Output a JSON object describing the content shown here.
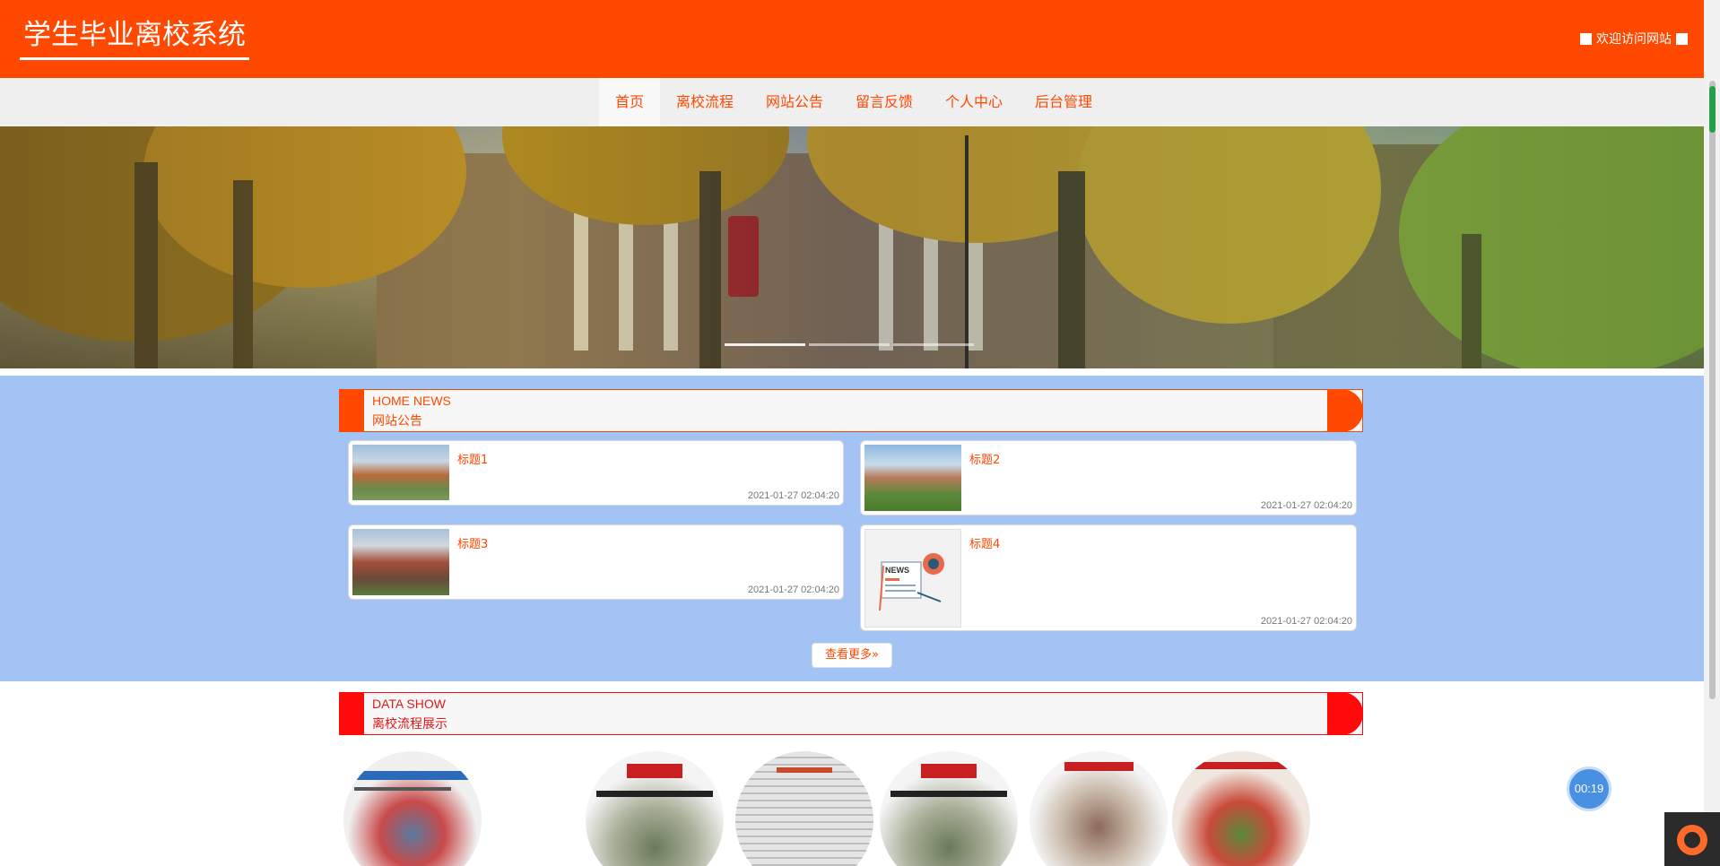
{
  "header": {
    "site_title": "学生毕业离校系统",
    "welcome": "欢迎访问网站",
    "bg_color": "#ff4800"
  },
  "nav": {
    "items": [
      {
        "label": "首页",
        "active": true
      },
      {
        "label": "离校流程",
        "active": false
      },
      {
        "label": "网站公告",
        "active": false
      },
      {
        "label": "留言反馈",
        "active": false
      },
      {
        "label": "个人中心",
        "active": false
      },
      {
        "label": "后台管理",
        "active": false
      }
    ]
  },
  "banner": {
    "slides_count": 3,
    "active_slide": 1
  },
  "news": {
    "section_en": "HOME NEWS",
    "section_cn": "网站公告",
    "items": [
      {
        "title": "标题1",
        "date": "2021-01-27 02:04:20",
        "icon": "school-building-photo"
      },
      {
        "title": "标题2",
        "date": "2021-01-27 02:04:20",
        "icon": "campus-photo"
      },
      {
        "title": "标题3",
        "date": "2021-01-27 02:04:20",
        "icon": "campus-building-photo"
      },
      {
        "title": "标题4",
        "date": "2021-01-27 02:04:20",
        "icon": "news-icon"
      }
    ],
    "more_label": "查看更多»"
  },
  "datashow": {
    "section_en": "DATA SHOW",
    "section_cn": "离校流程展示",
    "items_count": 6
  },
  "widgets": {
    "timer": "00:19"
  },
  "colors": {
    "accent": "#ff4800",
    "news_bg": "#a4c3f5",
    "datashow_accent": "#ff0a0a"
  }
}
